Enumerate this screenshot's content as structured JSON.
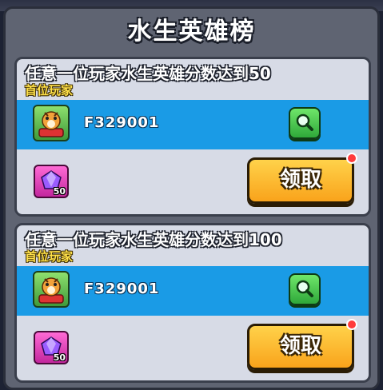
{
  "dialog": {
    "title": "水生英雄榜"
  },
  "cards": [
    {
      "task_text": "任意一位玩家水生英雄分数达到50",
      "first_player_label": "首位玩家",
      "player_id": "F329001",
      "reward_icon": "purple-gem-icon",
      "reward_count": "50",
      "claim_label": "领取",
      "has_notification": true
    },
    {
      "task_text": "任意一位玩家水生英雄分数达到100",
      "first_player_label": "首位玩家",
      "player_id": "F329001",
      "reward_icon": "purple-gem-icon",
      "reward_count": "50",
      "claim_label": "领取",
      "has_notification": true
    }
  ],
  "colors": {
    "panel": "#5f6472",
    "card": "#d7dbe6",
    "player_row": "#1a9be6",
    "claim_button": "#f9a31b",
    "search_button": "#2fa83a",
    "first_player_label": "#ffe14a",
    "notification_dot": "#ff3b3b"
  }
}
